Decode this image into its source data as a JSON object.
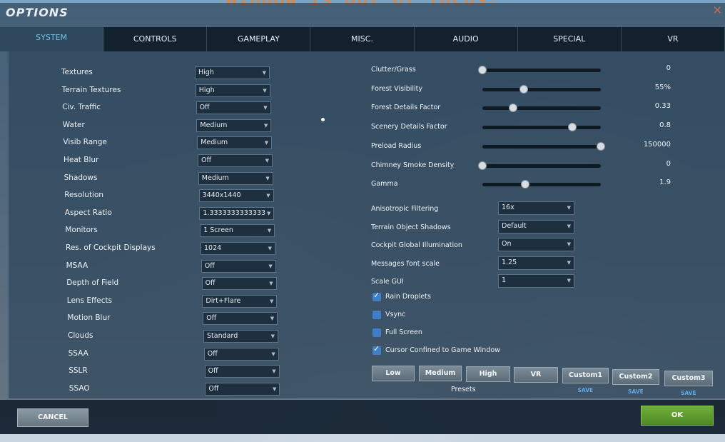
{
  "warning_text": "Window is out of focus!",
  "window": {
    "title": "OPTIONS",
    "close_icon": "×"
  },
  "tabs": [
    {
      "label": "SYSTEM",
      "active": true
    },
    {
      "label": "CONTROLS"
    },
    {
      "label": "GAMEPLAY"
    },
    {
      "label": "MISC."
    },
    {
      "label": "AUDIO"
    },
    {
      "label": "SPECIAL"
    },
    {
      "label": "VR"
    }
  ],
  "left_settings": [
    {
      "label": "Textures",
      "value": "High"
    },
    {
      "label": "Terrain Textures",
      "value": "High"
    },
    {
      "label": "Civ. Traffic",
      "value": "Off"
    },
    {
      "label": "Water",
      "value": "Medium"
    },
    {
      "label": "Visib Range",
      "value": "Medium"
    },
    {
      "label": "Heat Blur",
      "value": "Off"
    },
    {
      "label": "Shadows",
      "value": "Medium"
    },
    {
      "label": "Resolution",
      "value": "3440x1440"
    },
    {
      "label": "Aspect Ratio",
      "value": "1.3333333333333"
    },
    {
      "label": "Monitors",
      "value": "1 Screen"
    },
    {
      "label": "Res. of Cockpit Displays",
      "value": "1024"
    },
    {
      "label": "MSAA",
      "value": "Off"
    },
    {
      "label": "Depth of Field",
      "value": "Off"
    },
    {
      "label": "Lens Effects",
      "value": "Dirt+Flare"
    },
    {
      "label": "Motion Blur",
      "value": "Off"
    },
    {
      "label": "Clouds",
      "value": "Standard"
    },
    {
      "label": "SSAA",
      "value": "Off"
    },
    {
      "label": "SSLR",
      "value": "Off"
    },
    {
      "label": "SSAO",
      "value": "Off"
    }
  ],
  "sliders": [
    {
      "label": "Clutter/Grass",
      "value": "0",
      "fraction": 0.0
    },
    {
      "label": "Forest Visibility",
      "value": "55%",
      "fraction": 0.35
    },
    {
      "label": "Forest Details Factor",
      "value": "0.33",
      "fraction": 0.26
    },
    {
      "label": "Scenery Details Factor",
      "value": "0.8",
      "fraction": 0.76
    },
    {
      "label": "Preload Radius",
      "value": "150000",
      "fraction": 1.0
    },
    {
      "label": "Chimney Smoke Density",
      "value": "0",
      "fraction": 0.0
    },
    {
      "label": "Gamma",
      "value": "1.9",
      "fraction": 0.36
    }
  ],
  "right_settings": [
    {
      "label": "Anisotropic Filtering",
      "value": "16x"
    },
    {
      "label": "Terrain Object Shadows",
      "value": "Default"
    },
    {
      "label": "Cockpit Global Illumination",
      "value": "On"
    },
    {
      "label": "Messages font scale",
      "value": "1.25"
    },
    {
      "label": "Scale GUI",
      "value": "1"
    }
  ],
  "checkboxes": [
    {
      "label": "Rain Droplets",
      "checked": true
    },
    {
      "label": "Vsync",
      "checked": false
    },
    {
      "label": "Full Screen",
      "checked": false
    },
    {
      "label": "Cursor Confined to Game Window",
      "checked": true
    }
  ],
  "presets": {
    "label": "Presets",
    "buttons": [
      "Low",
      "Medium",
      "High",
      "VR",
      "Custom1",
      "Custom2",
      "Custom3"
    ],
    "save_label": "SAVE"
  },
  "footer": {
    "cancel_label": "CANCEL",
    "ok_label": "OK"
  },
  "colors": {
    "accent_tab": "#6fc3e6",
    "ok_green": "#5f9c30",
    "checkbox_blue": "#3f7fc7",
    "warning": "#f08030"
  }
}
